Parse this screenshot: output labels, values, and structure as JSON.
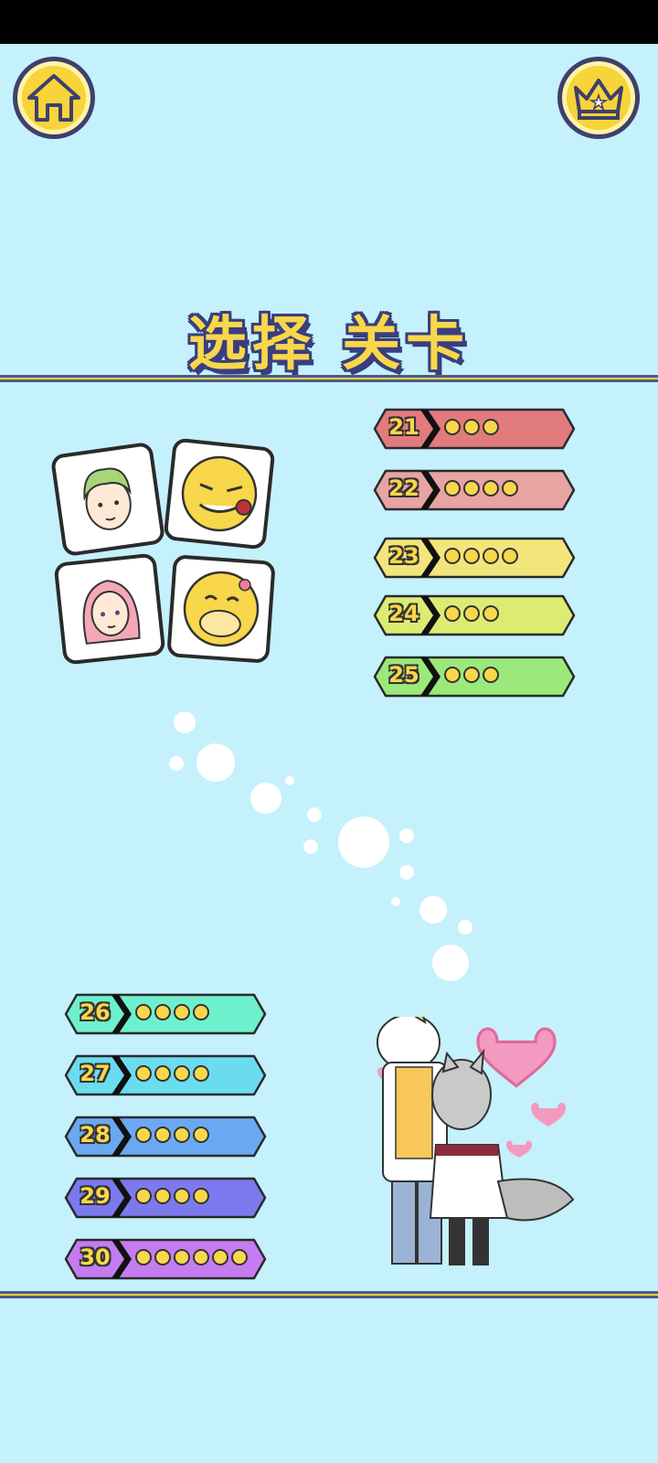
{
  "title": "选择 关卡",
  "buttons": {
    "home": "home-icon",
    "crown": "crown-icon"
  },
  "levels_right": [
    {
      "number": "21",
      "color": "#e27b7d",
      "dots": 3
    },
    {
      "number": "22",
      "color": "#e8a3a3",
      "dots": 4
    },
    {
      "number": "23",
      "color": "#f1e57c",
      "dots": 4
    },
    {
      "number": "24",
      "color": "#dcec73",
      "dots": 3
    },
    {
      "number": "25",
      "color": "#9be97a",
      "dots": 3
    }
  ],
  "levels_left": [
    {
      "number": "26",
      "color": "#6ff0cc",
      "dots": 4
    },
    {
      "number": "27",
      "color": "#6bdcf0",
      "dots": 4
    },
    {
      "number": "28",
      "color": "#6aa9f1",
      "dots": 4
    },
    {
      "number": "29",
      "color": "#7c79ef",
      "dots": 4
    },
    {
      "number": "30",
      "color": "#c57cf0",
      "dots": 6
    }
  ],
  "colors": {
    "background": "#c4f1fb",
    "accent": "#f6d43a",
    "outline": "#3a3e7e"
  }
}
